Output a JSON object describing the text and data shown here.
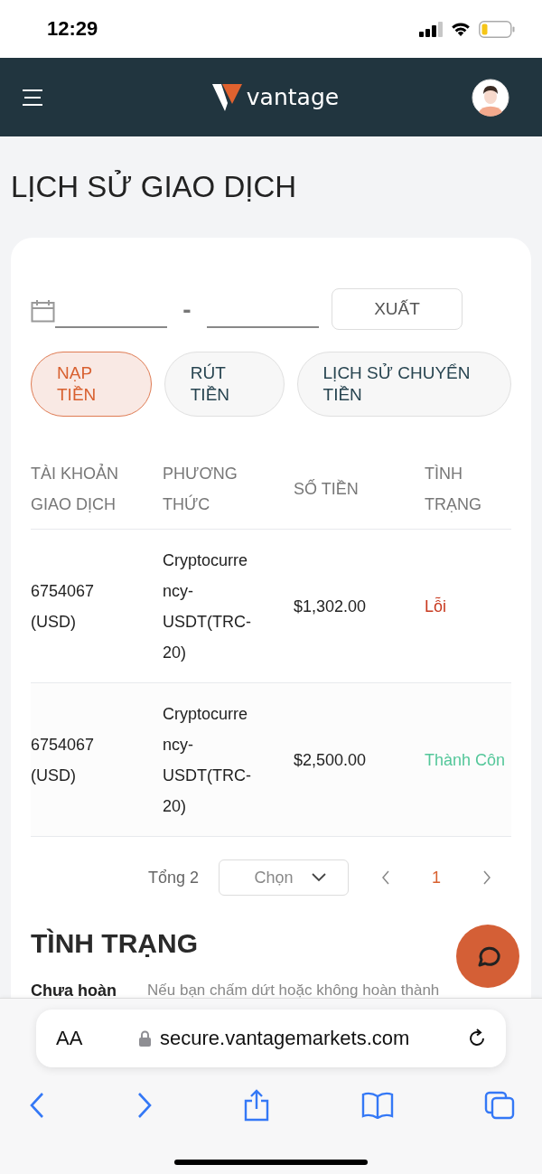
{
  "status_bar": {
    "time": "12:29"
  },
  "header": {
    "logo_text": "vantage"
  },
  "page_title": "LỊCH SỬ GIAO DỊCH",
  "filters": {
    "export_button": "XUẤT",
    "separator": "-"
  },
  "tabs": [
    {
      "label": "NẠP TIỀN",
      "selected": true
    },
    {
      "label": "RÚT TIỀN",
      "selected": false
    },
    {
      "label": "LỊCH SỬ CHUYỂN TIỀN",
      "selected": false
    }
  ],
  "table": {
    "columns": [
      "TÀI KHOẢN GIAO DỊCH",
      "PHƯƠNG THỨC",
      "SỐ TIỀN",
      "TÌNH TRẠNG"
    ],
    "rows": [
      {
        "account": "6754067 (USD)",
        "method": "Cryptocurrency-USDT(TRC-20)",
        "amount": "$1,302.00",
        "status": "Lỗi",
        "kind": "error"
      },
      {
        "account": "6754067 (USD)",
        "method": "Cryptocurrency-USDT(TRC-20)",
        "amount": "$2,500.00",
        "status": "Thành Côn",
        "kind": "success"
      }
    ]
  },
  "pagination": {
    "total": "Tổng 2",
    "page_size_placeholder": "Chọn",
    "pages": [
      {
        "label": "1",
        "selected": true
      }
    ]
  },
  "status_section": {
    "title": "TÌNH TRẠNG",
    "term": "Chưa hoàn",
    "description": "Nếu bạn chấm dứt hoặc không hoàn thành"
  },
  "browser": {
    "text_size_button": "AA",
    "url": "secure.vantagemarkets.com"
  }
}
